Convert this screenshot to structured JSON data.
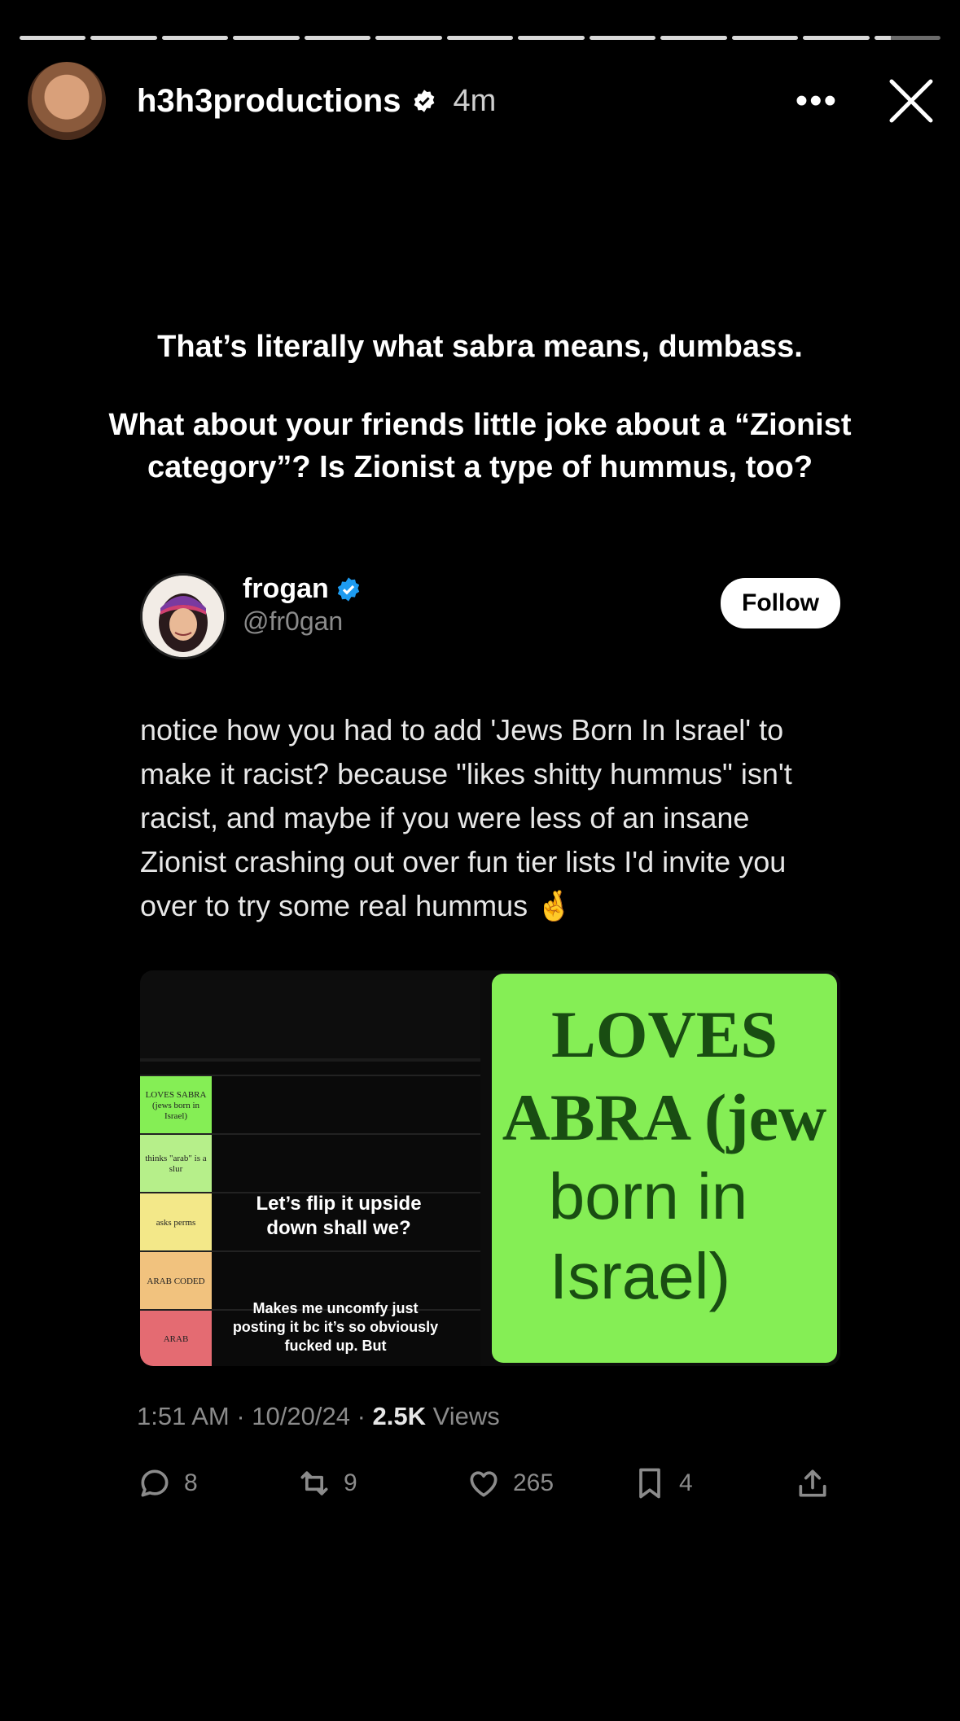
{
  "story": {
    "username": "h3h3productions",
    "time": "4m",
    "more_label": "•••"
  },
  "caption": {
    "line1": "That’s literally what sabra means, dumbass.",
    "line2": "What about your friends little joke about a “Zionist category”? Is Zionist a type of hummus, too?"
  },
  "tweet": {
    "name": "frogan",
    "handle": "@fr0gan",
    "follow_label": "Follow",
    "text": "notice how you had to add 'Jews Born In Israel' to make it racist? because \"likes shitty hummus\" isn't racist, and maybe if you were less of an insane Zionist crashing out over fun tier lists I'd invite you over to try some real hummus 🤞",
    "media": {
      "tiers": [
        "LOVES SABRA (jews born in Israel)",
        "thinks \"arab\" is a slur",
        "asks perms",
        "ARAB CODED",
        "ARAB"
      ],
      "overlay_top": "Let’s flip it upside down shall we?",
      "overlay_bottom": "Makes me uncomfy just posting it bc it’s so obviously fucked up. But",
      "zoom_lines": [
        "LOVES",
        "ABRA (jew",
        "born in",
        "Israel)"
      ]
    },
    "timestamp": "1:51 AM · 10/20/24 · ",
    "views_count": "2.5K",
    "views_label": " Views",
    "replies": "8",
    "reposts": "9",
    "likes": "265",
    "bookmarks": "4"
  },
  "colors": {
    "background": "#000000",
    "verified": "#1d9bf0",
    "tier_green": "#85ee55",
    "tier_lightgreen": "#b6ef8a",
    "tier_yellow": "#f3e889",
    "tier_orange": "#f1c27e",
    "tier_red": "#e46b72"
  }
}
